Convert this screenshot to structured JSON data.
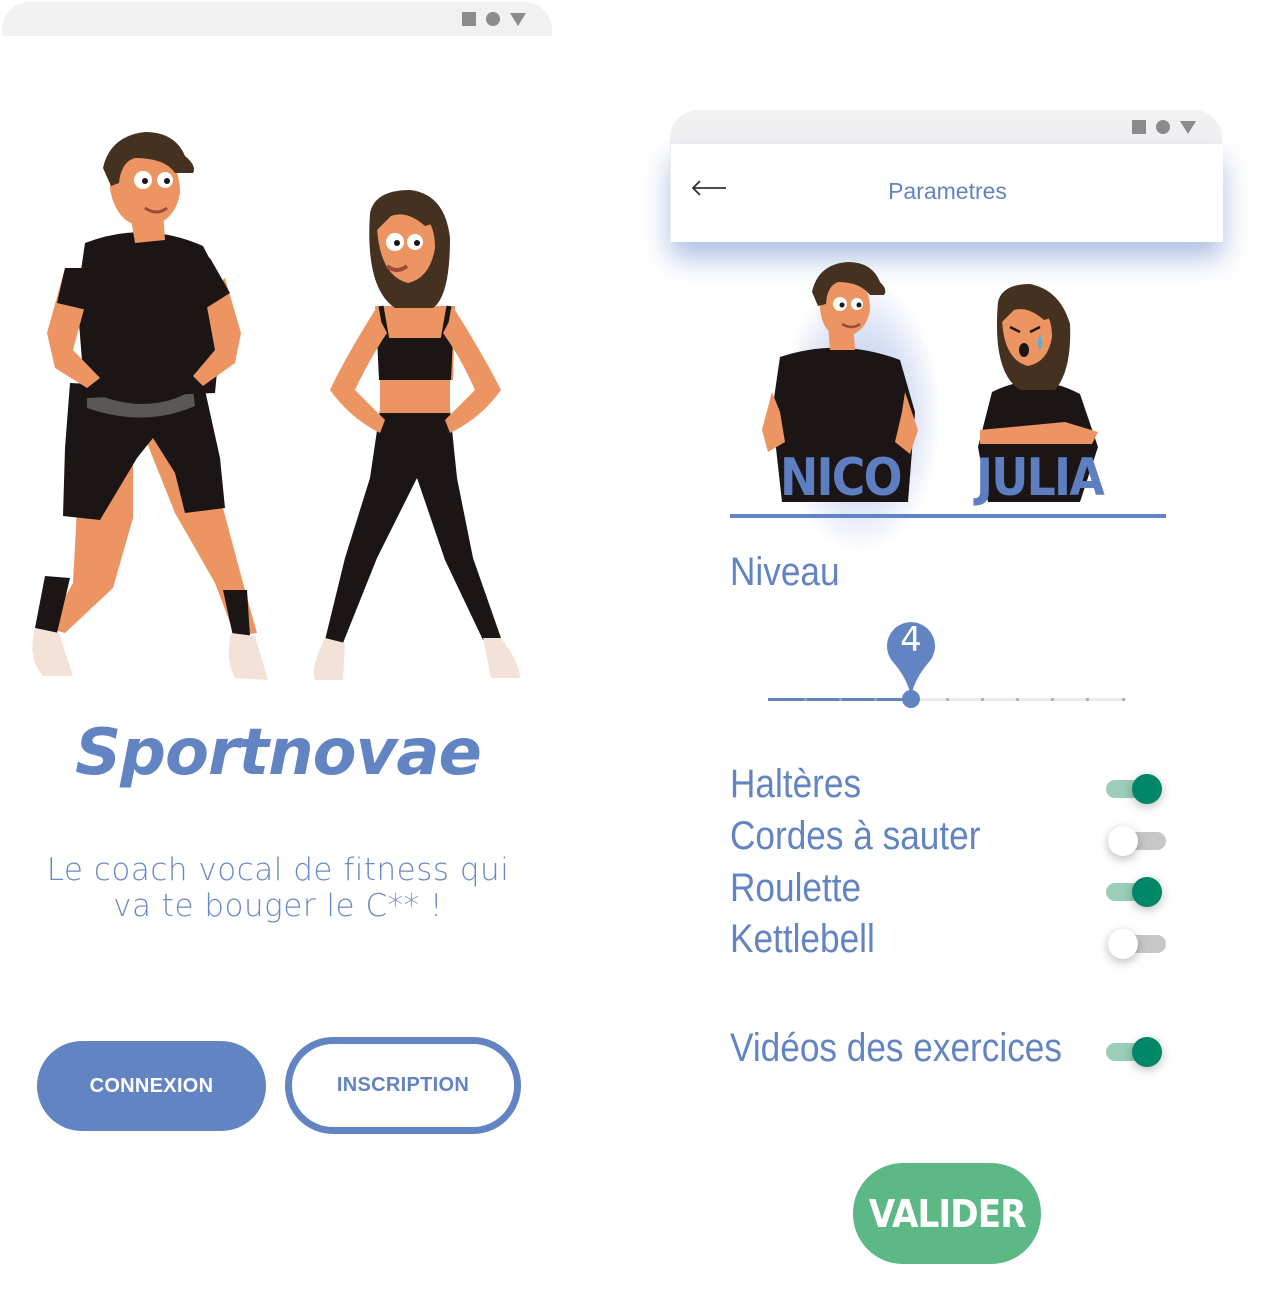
{
  "login_screen": {
    "app_title": "Sportnovae",
    "tagline": "Le coach vocal de  fitness qui va te bouger le C** !",
    "connexion_label": "CONNEXION",
    "inscription_label": "INSCRIPTION"
  },
  "settings_screen": {
    "header_title": "Parametres",
    "profiles": [
      {
        "name": "NICO",
        "selected": true
      },
      {
        "name": "JULIA",
        "selected": false
      }
    ],
    "level": {
      "label": "Niveau",
      "value": "4",
      "min": 1,
      "max": 11
    },
    "equipment": [
      {
        "label": "Haltères",
        "enabled": true
      },
      {
        "label": "Cordes à sauter",
        "enabled": false
      },
      {
        "label": "Roulette",
        "enabled": true
      },
      {
        "label": "Kettlebell",
        "enabled": false
      }
    ],
    "videos": {
      "label": "Vidéos des exercices",
      "enabled": true
    },
    "submit_label": "VALIDER"
  },
  "colors": {
    "primary_blue": "#6384c3",
    "toggle_on": "#008768",
    "toggle_on_track": "#9bcdb8",
    "toggle_off_track": "#c7c7c7",
    "submit_green": "#5cb885",
    "chrome_gray": "#f1f1f2"
  },
  "icons": {
    "status": [
      "square-icon",
      "circle-icon",
      "triangle-down-icon"
    ],
    "back": "back-arrow-icon"
  }
}
